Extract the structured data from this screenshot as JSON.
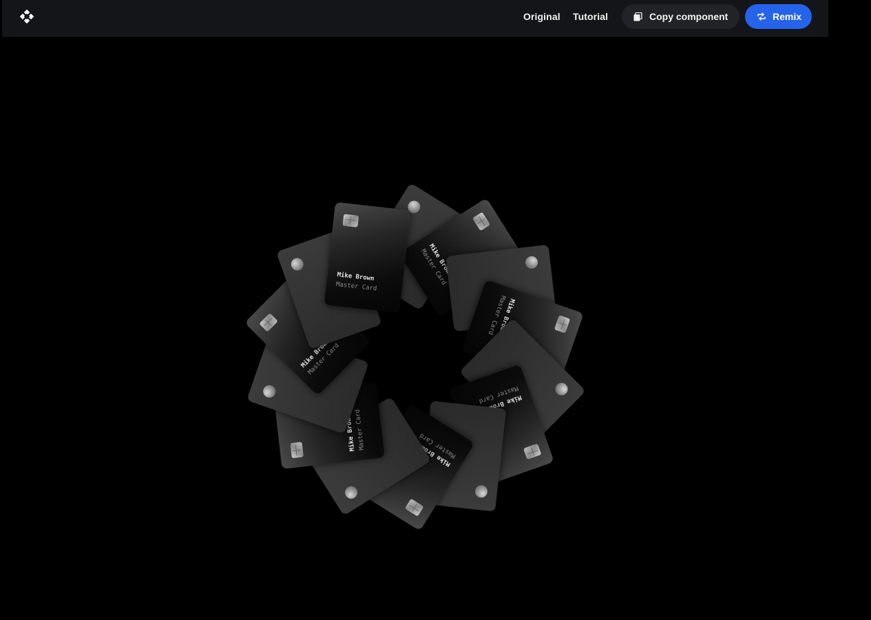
{
  "header": {
    "logo_icon": "diamond-cluster-logo-icon",
    "nav": [
      {
        "label": "Original"
      },
      {
        "label": "Tutorial"
      }
    ],
    "copy_button": {
      "label": "Copy component",
      "icon": "copy-icon"
    },
    "remix_button": {
      "label": "Remix",
      "icon": "remix-icon",
      "color": "#2563eb"
    }
  },
  "card_front": {
    "name": "Mike Brown",
    "type": "Master Card"
  },
  "colors": {
    "background": "#000000",
    "header": "#141518",
    "accent": "#2563eb"
  }
}
